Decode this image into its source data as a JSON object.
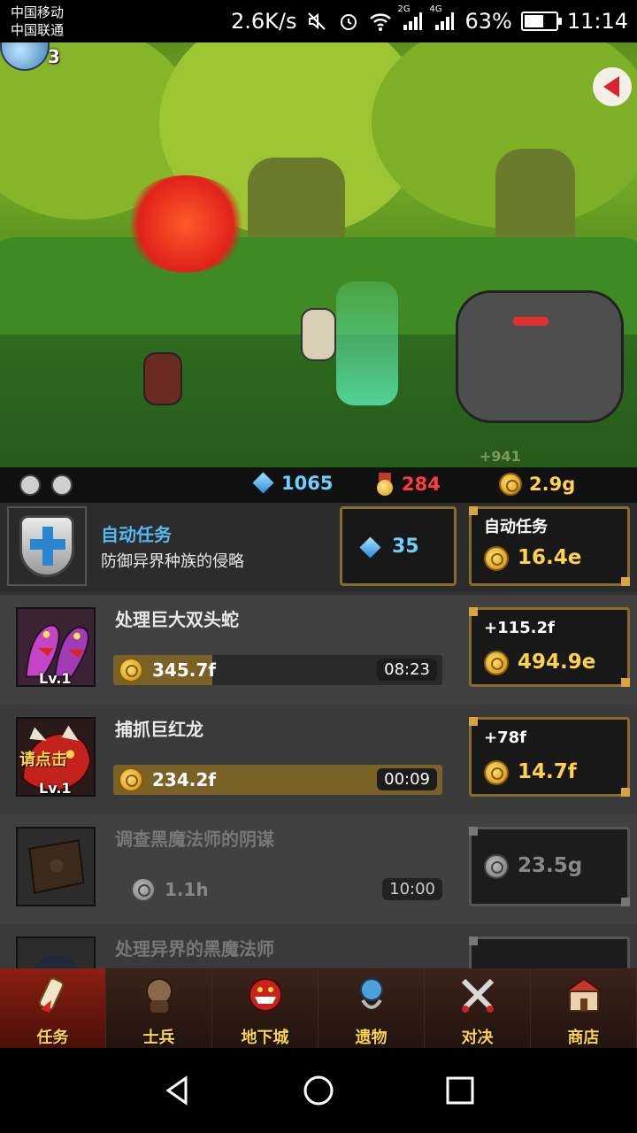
{
  "status_bar": {
    "carrier1": "中国移动",
    "carrier2": "中国联通",
    "net_speed": "2.6K/s",
    "net_2g": "2G",
    "net_4g": "4G",
    "battery": "63%",
    "battery_level": 0.63,
    "time": "11:14"
  },
  "scene": {
    "level": "3",
    "damage": "+941"
  },
  "resources": {
    "diamonds": "1065",
    "medals": "284",
    "gold": "2.9g"
  },
  "auto_quest": {
    "title": "自动任务",
    "desc": "防御异界种族的侵略",
    "gem_cost": "35",
    "btn_label": "自动任务",
    "btn_amount": "16.4e"
  },
  "quests": [
    {
      "title": "处理巨大双头蛇",
      "level": "Lv.1",
      "reward": "345.7f",
      "time": "08:23",
      "progress": 0.3,
      "gain": "+115.2f",
      "cost": "494.9e"
    },
    {
      "title": "捕抓巨红龙",
      "level": "Lv.1",
      "tap_hint": "请点击",
      "reward": "234.2f",
      "time": "00:09",
      "progress": 1.0,
      "gain": "+78f",
      "cost": "14.7f"
    },
    {
      "title": "调查黑魔法师的阴谋",
      "reward": "1.1h",
      "time": "10:00",
      "cost": "23.5g"
    },
    {
      "title": "处理异界的黑魔法师"
    }
  ],
  "nav": [
    {
      "label": "任务",
      "icon": "scroll-icon"
    },
    {
      "label": "士兵",
      "icon": "soldier-icon"
    },
    {
      "label": "地下城",
      "icon": "dungeon-icon"
    },
    {
      "label": "遗物",
      "icon": "relic-icon"
    },
    {
      "label": "对决",
      "icon": "swords-icon"
    },
    {
      "label": "商店",
      "icon": "shop-icon"
    }
  ],
  "colors": {
    "accent_gold": "#ffd24a",
    "diamond_blue": "#6fd0ff",
    "medal_red": "#ff3b3b",
    "active_tab": "#8c1f12"
  }
}
